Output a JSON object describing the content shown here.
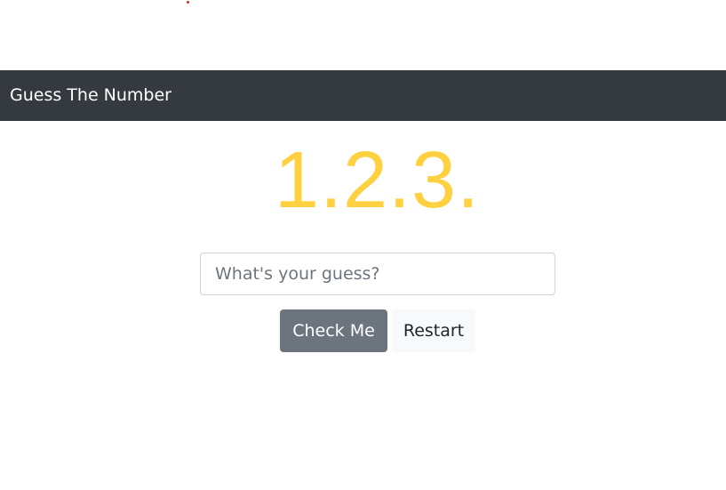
{
  "navbar": {
    "brand": "Guess The Number"
  },
  "game": {
    "display_number": "1.2.3."
  },
  "guess": {
    "value": "",
    "placeholder": "What's your guess?"
  },
  "buttons": {
    "check_label": "Check Me",
    "restart_label": "Restart"
  },
  "colors": {
    "navbar_bg": "#343a40",
    "number_color": "#ffd140",
    "check_button_bg": "#6c757d",
    "restart_button_bg": "#f8f9fa"
  }
}
